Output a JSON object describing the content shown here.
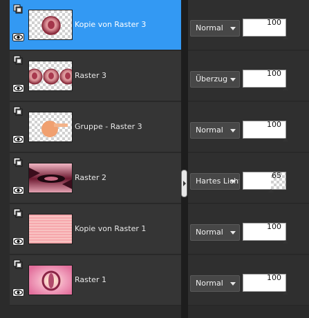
{
  "colors": {
    "selection": "#3399f3",
    "panel": "#353535",
    "background": "#2b2b2b"
  },
  "layers": [
    {
      "name": "Kopie von Raster 3",
      "blend_mode": "Normal",
      "opacity": 100,
      "selected": true,
      "thumb": "circle-lady",
      "visibility_icon": "layer-visibility-icon",
      "eye_icon": "eye-icon"
    },
    {
      "name": "Raster 3",
      "blend_mode": "Überzug",
      "opacity": 100,
      "selected": false,
      "thumb": "three-circles",
      "visibility_icon": "layer-visibility-icon",
      "eye_icon": "eye-icon"
    },
    {
      "name": "Gruppe - Raster 3",
      "blend_mode": "Normal",
      "opacity": 100,
      "selected": false,
      "thumb": "orange-blob",
      "visibility_icon": "layer-visibility-icon",
      "eye_icon": "eye-icon"
    },
    {
      "name": "Raster 2",
      "blend_mode": "Hartes Licht",
      "opacity": 65,
      "selected": false,
      "thumb": "dark-pink-pattern",
      "visibility_icon": "layer-visibility-icon",
      "eye_icon": "eye-icon"
    },
    {
      "name": "Kopie von Raster 1",
      "blend_mode": "Normal",
      "opacity": 100,
      "selected": false,
      "thumb": "pink-stripes",
      "visibility_icon": "layer-visibility-icon",
      "eye_icon": "eye-icon"
    },
    {
      "name": "Raster 1",
      "blend_mode": "Normal",
      "opacity": 100,
      "selected": false,
      "thumb": "pink-glow",
      "visibility_icon": "layer-visibility-icon",
      "eye_icon": "eye-icon"
    }
  ]
}
